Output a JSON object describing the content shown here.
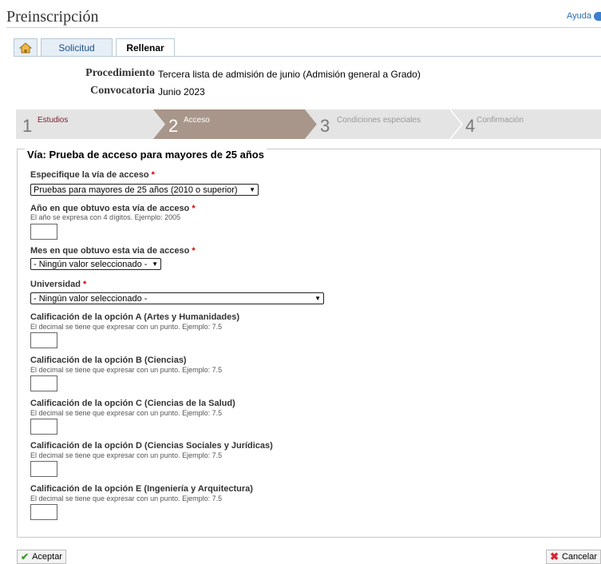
{
  "page": {
    "title": "Preinscripción",
    "help": "Ayuda"
  },
  "tabs": {
    "solicitud": "Solicitud",
    "rellenar": "Rellenar"
  },
  "info": {
    "procedimiento_label": "Procedimiento",
    "procedimiento_value": "Tercera lista de admisión de junio (Admisión general a Grado)",
    "convocatoria_label": "Convocatoria",
    "convocatoria_value": "Junio 2023"
  },
  "steps": [
    {
      "num": "1",
      "label": "Estudios"
    },
    {
      "num": "2",
      "label": "Acceso"
    },
    {
      "num": "3",
      "label": "Condiciones especiales"
    },
    {
      "num": "4",
      "label": "Confirmación"
    }
  ],
  "form": {
    "legend": "Vía: Prueba de acceso para mayores de 25 años",
    "required_mark": "*",
    "via": {
      "label": "Especifique la vía de acceso",
      "value": "Pruebas para mayores de 25 años (2010 o superior)"
    },
    "anio": {
      "label": "Año en que obtuvo esta vía de acceso",
      "hint": "El año se expresa con 4 dígitos. Ejemplo: 2005"
    },
    "mes": {
      "label": "Mes en que obtuvo esta via de acceso",
      "value": "- Ningún valor seleccionado -"
    },
    "universidad": {
      "label": "Universidad",
      "value": "- Ningún valor seleccionado -"
    },
    "grade_hint": "El decimal se tiene que expresar con un punto. Ejemplo: 7.5",
    "grades": [
      "Calificación de la opción A (Artes y Humanidades)",
      "Calificación de la opción B (Ciencias)",
      "Calificación de la opción C (Ciencias de la Salud)",
      "Calificación de la opción D (Ciencias Sociales y Jurídicas)",
      "Calificación de la opción E (Ingeniería y Arquitectura)"
    ]
  },
  "buttons": {
    "accept": "Aceptar",
    "cancel": "Cancelar"
  },
  "colors": {
    "step_active": "#a8968a",
    "step_inactive": "#e4e4e4",
    "link": "#2a6db5",
    "required": "#cc0000"
  }
}
